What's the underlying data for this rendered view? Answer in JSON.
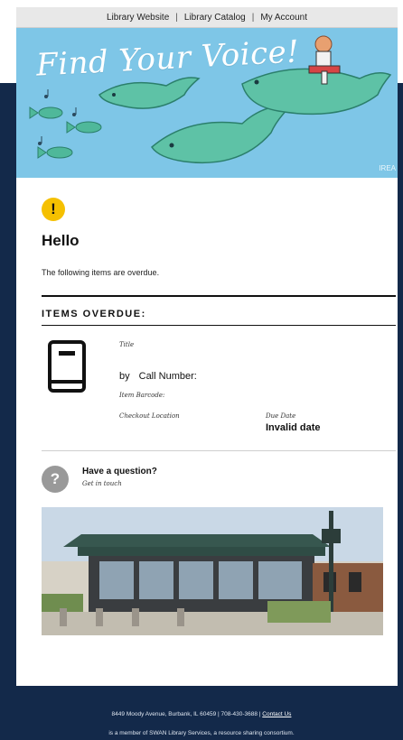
{
  "topnav": {
    "links": [
      "Library Website",
      "Library Catalog",
      "My Account"
    ],
    "separator": "|"
  },
  "banner": {
    "title": "Find Your Voice!",
    "credit": "IREA"
  },
  "greeting": "Hello",
  "intro_text": "The following items are overdue.",
  "section_title": "ITEMS OVERDUE:",
  "item": {
    "title_label": "Title",
    "by_label": "by",
    "call_number_label": "Call Number:",
    "barcode_label": "Item Barcode:",
    "checkout_location_label": "Checkout Location",
    "due_date_label": "Due Date",
    "due_date_value": "Invalid date",
    "icon": "book-icon"
  },
  "question": {
    "title": "Have a question?",
    "subtitle": "Get in touch",
    "icon": "question-icon"
  },
  "footer": {
    "address": "8449 Moody Avenue, Burbank, IL 60459 | 708-430-3688 |",
    "contact_link": "Contact Us",
    "member_text": "is a member of SWAN Library Services, a resource sharing consortium."
  },
  "colors": {
    "navy": "#13294a",
    "banner_blue": "#7ec6e7",
    "alert_yellow": "#f5c000",
    "question_gray": "#999999"
  }
}
